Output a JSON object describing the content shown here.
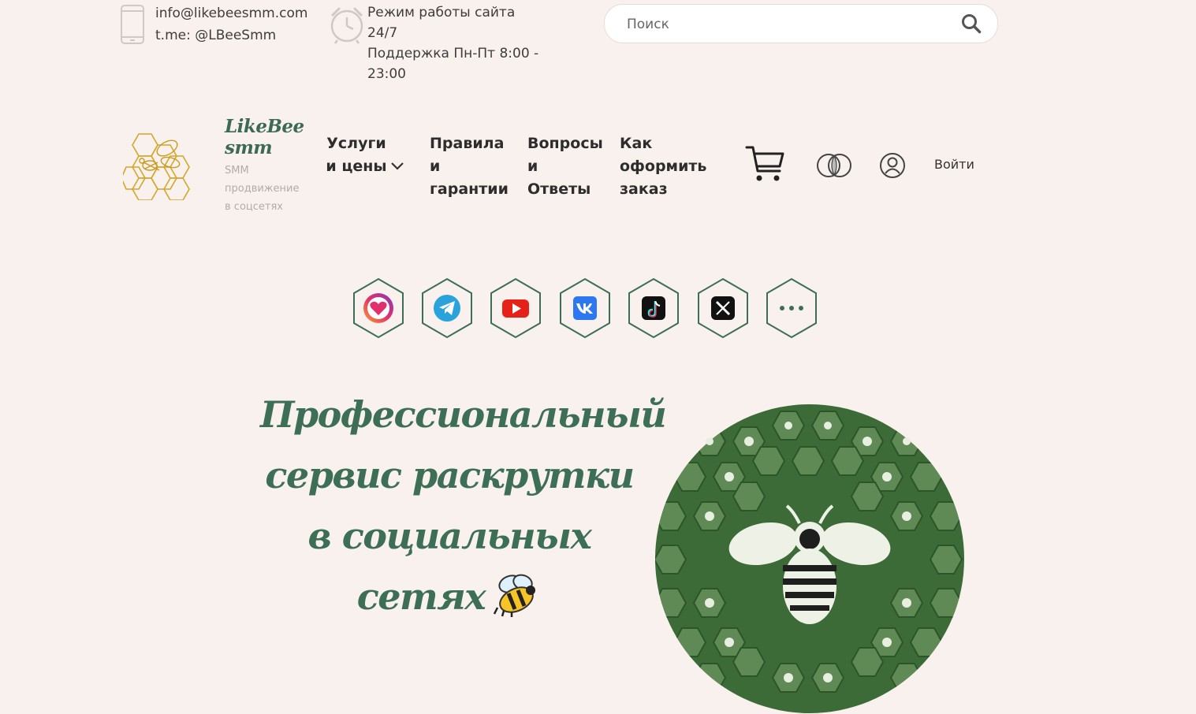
{
  "topbar": {
    "email": "info@likebeesmm.com",
    "telegram": "t.me: @LBeeSmm",
    "hours_line1": "Режим работы сайта 24/7",
    "hours_line2": "Поддержка Пн-Пт 8:00 - 23:00",
    "search_placeholder": "Поиск"
  },
  "brand": {
    "name": "LikeBee smm",
    "tagline": "SMM продвижение в соцсетях"
  },
  "nav": {
    "services": "Услуги и цены",
    "rules": "Правила и гарантии",
    "faq": "Вопросы и Ответы",
    "howto": "Как оформить заказ"
  },
  "account": {
    "login": "Войти"
  },
  "socials": [
    {
      "icon": "instagram-like-icon",
      "color": "#d62976"
    },
    {
      "icon": "telegram-icon",
      "color": "#2aa3dd"
    },
    {
      "icon": "youtube-icon",
      "color": "#e62117"
    },
    {
      "icon": "vk-icon",
      "color": "#2d78f0"
    },
    {
      "icon": "tiktok-icon",
      "color": "#111111"
    },
    {
      "icon": "x-icon",
      "color": "#111111"
    },
    {
      "icon": "more-icon",
      "color": "#3d6f56"
    }
  ],
  "hero": {
    "title": "Профессиональный сервис раскрутки в социальных сетях"
  },
  "colors": {
    "background": "#f9f1ed",
    "brand_green": "#3d6f56",
    "logo_gold": "#d4a62a"
  }
}
